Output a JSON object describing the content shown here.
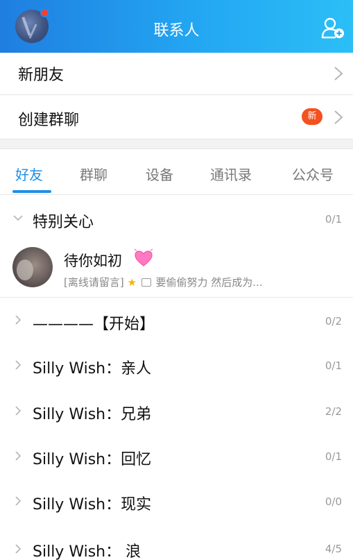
{
  "header": {
    "title": "联系人"
  },
  "top_rows": {
    "new_friends": "新朋友",
    "create_group": "创建群聊",
    "new_badge": "新"
  },
  "tabs": [
    {
      "label": "好友"
    },
    {
      "label": "群聊"
    },
    {
      "label": "设备"
    },
    {
      "label": "通讯录"
    },
    {
      "label": "公众号"
    }
  ],
  "groups": [
    {
      "label": "特别关心",
      "count": "0/1"
    },
    {
      "label": "————【开始】",
      "count": "0/2"
    },
    {
      "label": "Silly Wish：亲人",
      "count": "0/1"
    },
    {
      "label": "Silly Wish：兄弟",
      "count": "2/2"
    },
    {
      "label": "Silly Wish：回忆",
      "count": "0/1"
    },
    {
      "label": "Silly Wish：现实",
      "count": "0/0"
    },
    {
      "label": "Silly Wish： 浪",
      "count": "4/5"
    }
  ],
  "contact": {
    "name": "待你如初",
    "status_prefix": "[离线请留言]",
    "status_text": "要偷偷努力 然后成为..."
  },
  "colors": {
    "header_gradient_start": "#1f7ee0",
    "header_gradient_end": "#2bbff6",
    "accent": "#1e8fe8",
    "badge": "#f4511e"
  },
  "icons": {
    "add_contact": "add-contact-icon",
    "chevron_right": "chevron-right-icon",
    "chevron_down": "chevron-down-icon",
    "heart": "heart-icon",
    "star": "star-icon",
    "image": "image-icon"
  }
}
